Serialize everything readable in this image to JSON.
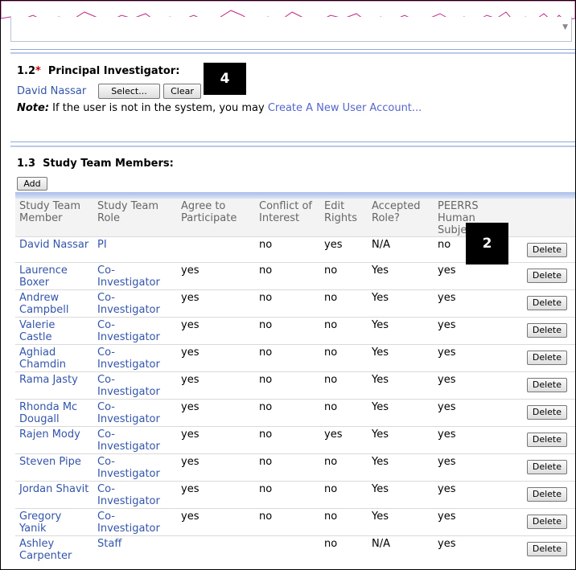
{
  "principal_investigator": {
    "section_number": "1.2",
    "required_marker": "*",
    "title": "Principal Investigator:",
    "name": "David Nassar",
    "select_label": "Select...",
    "clear_label": "Clear",
    "note_label": "Note:",
    "note_text": " If the user is not in the system, you may ",
    "create_link": "Create A New User Account..."
  },
  "callouts": {
    "four": "4",
    "two": "2"
  },
  "team": {
    "section_number": "1.3",
    "title": "Study Team Members:",
    "add_label": "Add",
    "columns": [
      "Study Team Member",
      "Study Team Role",
      "Agree to Participate",
      "Conflict of Interest",
      "Edit Rights",
      "Accepted Role?",
      "PEERRS Human Subje"
    ],
    "delete_label": "Delete",
    "rows": [
      {
        "member": "David Nassar",
        "role": "PI",
        "agree": "",
        "conflict": "no",
        "edit": "yes",
        "accepted": "N/A",
        "peerrs": "no"
      },
      {
        "member": "Laurence Boxer",
        "role": "Co-Investigator",
        "agree": "yes",
        "conflict": "no",
        "edit": "no",
        "accepted": "Yes",
        "peerrs": "yes"
      },
      {
        "member": "Andrew Campbell",
        "role": "Co-Investigator",
        "agree": "yes",
        "conflict": "no",
        "edit": "no",
        "accepted": "Yes",
        "peerrs": "yes"
      },
      {
        "member": "Valerie Castle",
        "role": "Co-Investigator",
        "agree": "yes",
        "conflict": "no",
        "edit": "no",
        "accepted": "Yes",
        "peerrs": "yes"
      },
      {
        "member": "Aghiad Chamdin",
        "role": "Co-Investigator",
        "agree": "yes",
        "conflict": "no",
        "edit": "no",
        "accepted": "Yes",
        "peerrs": "yes"
      },
      {
        "member": "Rama Jasty",
        "role": "Co-Investigator",
        "agree": "yes",
        "conflict": "no",
        "edit": "no",
        "accepted": "Yes",
        "peerrs": "yes"
      },
      {
        "member": "Rhonda Mc Dougall",
        "role": "Co-Investigator",
        "agree": "yes",
        "conflict": "no",
        "edit": "no",
        "accepted": "Yes",
        "peerrs": "yes"
      },
      {
        "member": "Rajen Mody",
        "role": "Co-Investigator",
        "agree": "yes",
        "conflict": "no",
        "edit": "yes",
        "accepted": "Yes",
        "peerrs": "yes"
      },
      {
        "member": "Steven Pipe",
        "role": "Co-Investigator",
        "agree": "yes",
        "conflict": "no",
        "edit": "no",
        "accepted": "Yes",
        "peerrs": "yes"
      },
      {
        "member": "Jordan Shavit",
        "role": "Co-Investigator",
        "agree": "yes",
        "conflict": "no",
        "edit": "no",
        "accepted": "Yes",
        "peerrs": "yes"
      },
      {
        "member": "Gregory Yanik",
        "role": "Co-Investigator",
        "agree": "yes",
        "conflict": "no",
        "edit": "no",
        "accepted": "Yes",
        "peerrs": "yes"
      },
      {
        "member": "Ashley Carpenter",
        "role": "Staff",
        "agree": "",
        "conflict": "",
        "edit": "no",
        "accepted": "N/A",
        "peerrs": "yes"
      }
    ]
  }
}
